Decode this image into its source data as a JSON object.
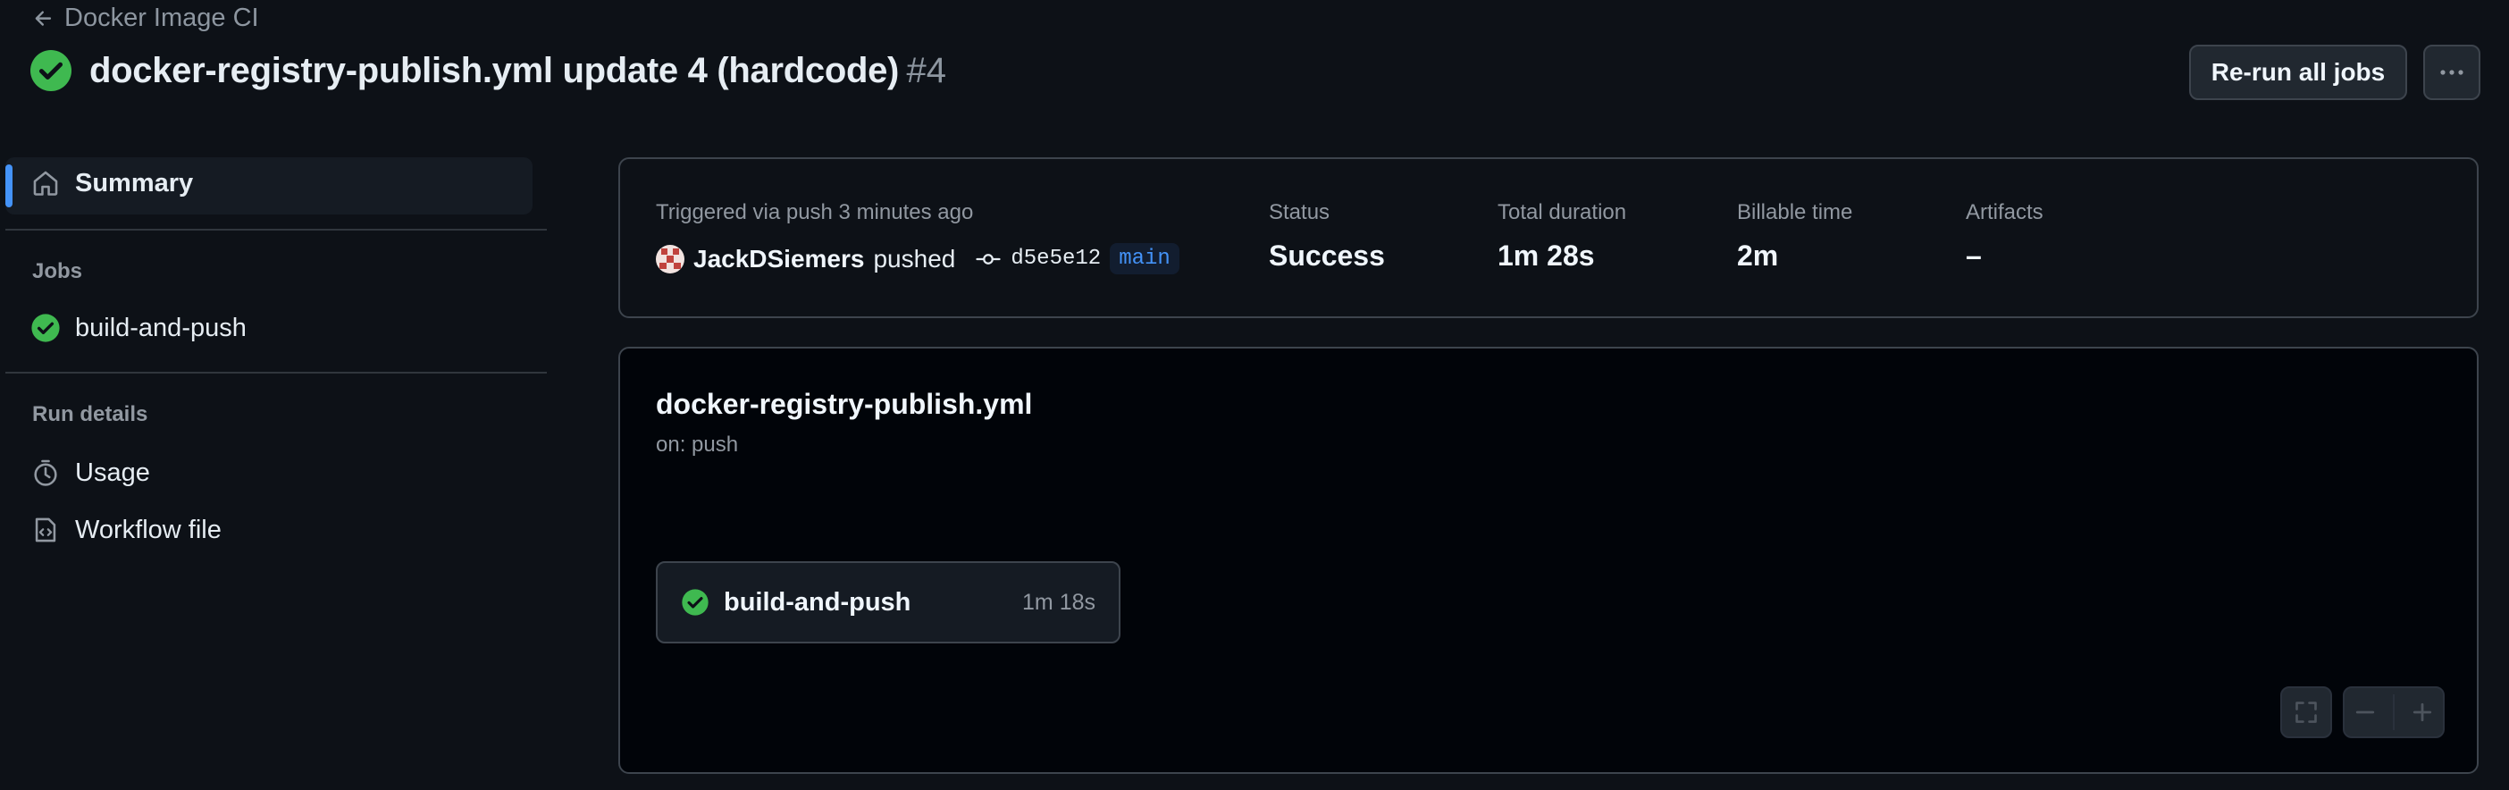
{
  "header": {
    "back_label": "Docker Image CI",
    "title": "docker-registry-publish.yml update 4 (hardcode)",
    "run_number": "#4",
    "rerun_label": "Re-run all jobs"
  },
  "sidebar": {
    "summary_label": "Summary",
    "jobs_heading": "Jobs",
    "jobs": [
      {
        "label": "build-and-push",
        "status": "success"
      }
    ],
    "run_details_heading": "Run details",
    "run_details": [
      {
        "label": "Usage",
        "icon": "stopwatch-icon"
      },
      {
        "label": "Workflow file",
        "icon": "file-code-icon"
      }
    ]
  },
  "summary": {
    "triggered_label": "Triggered via push 3 minutes ago",
    "actor": "JackDSiemers",
    "action": "pushed",
    "commit_sha": "d5e5e12",
    "branch": "main",
    "status_label": "Status",
    "status_value": "Success",
    "duration_label": "Total duration",
    "duration_value": "1m 28s",
    "billable_label": "Billable time",
    "billable_value": "2m",
    "artifacts_label": "Artifacts",
    "artifacts_value": "–"
  },
  "graph": {
    "workflow_name": "docker-registry-publish.yml",
    "trigger": "on: push",
    "job": {
      "name": "build-and-push",
      "duration": "1m 18s",
      "status": "success"
    }
  },
  "colors": {
    "background": "#0d1117",
    "success": "#3fb950",
    "accent": "#4493f8",
    "border": "#3d444d"
  }
}
